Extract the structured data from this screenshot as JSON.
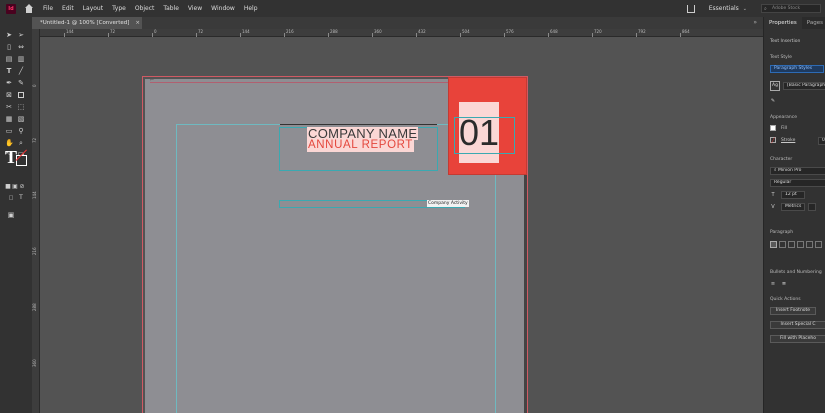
{
  "menubar": {
    "app_badge": "Id",
    "items": [
      "File",
      "Edit",
      "Layout",
      "Type",
      "Object",
      "Table",
      "View",
      "Window",
      "Help"
    ],
    "workspace": "Essentials",
    "workspace_chevron": "⌄",
    "search_placeholder": "Adobe Stock"
  },
  "doc_tab": {
    "title": "*Untitled-1 @ 100% [Converted]",
    "close": "×",
    "collapse": "»"
  },
  "ruler_top": {
    "labels": [
      "144",
      "72",
      "0",
      "72",
      "144",
      "216",
      "288",
      "360",
      "432",
      "504",
      "576",
      "648",
      "720",
      "792",
      "864"
    ]
  },
  "ruler_left": {
    "labels": [
      "0",
      "72",
      "144",
      "216",
      "288",
      "360",
      "432"
    ]
  },
  "document": {
    "company_name": "COMPANY NAME",
    "annual_report": "ANNUAL REPORT",
    "number": "01",
    "activity": "Company Activity",
    "accent_color": "#e8433a",
    "highlight_color": "#fbd7d5"
  },
  "panel": {
    "tabs": [
      "Properties",
      "Pages"
    ],
    "text_insertion": "Text Insertion",
    "text_style": "Text Style",
    "paragraph_styles": "Paragraph Styles",
    "style_icon": "Ag",
    "basic_paragraph": "[Basic Paragraph]",
    "appearance": "Appearance",
    "fill": "Fill",
    "stroke": "Stroke",
    "stroke_value": "0 p",
    "character": "Character",
    "font": "Minion Pro",
    "font_style": "Regular",
    "font_size": "12 pt",
    "kerning": "Metrics",
    "paragraph": "Paragraph",
    "bullets": "Bullets and Numbering",
    "quick_actions": "Quick Actions",
    "insert_footnote": "Insert Footnote",
    "insert_special": "Insert Special C",
    "fill_placeholder": "Fill with Placeho"
  }
}
